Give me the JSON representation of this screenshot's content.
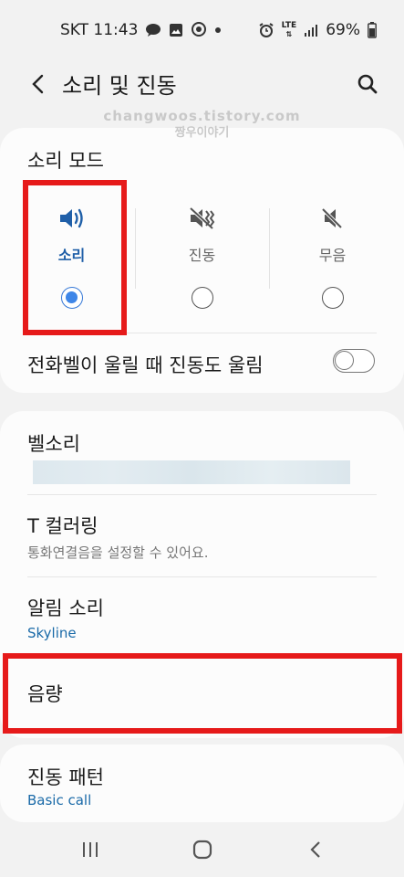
{
  "status_bar": {
    "carrier_time": "SKT 11:43",
    "battery": "69%",
    "lte_label": "LTE"
  },
  "header": {
    "title": "소리 및 진동"
  },
  "watermark": {
    "line1": "changwoos.tistory.com",
    "line2": "짱우이야기"
  },
  "sound_mode": {
    "title": "소리 모드",
    "options": [
      {
        "label": "소리",
        "selected": true
      },
      {
        "label": "진동",
        "selected": false
      },
      {
        "label": "무음",
        "selected": false
      }
    ],
    "vibrate_while_ringing_label": "전화벨이 울릴 때 진동도 울림",
    "vibrate_while_ringing_on": false
  },
  "settings": {
    "ringtone": {
      "title": "벨소리"
    },
    "t_coloring": {
      "title": "T 컬러링",
      "subtitle": "통화연결음을 설정할 수 있어요."
    },
    "notification_sound": {
      "title": "알림 소리",
      "subtitle": "Skyline"
    },
    "volume": {
      "title": "음량"
    },
    "vibration_pattern": {
      "title": "진동 패턴",
      "subtitle": "Basic call"
    }
  },
  "colors": {
    "accent_blue": "#1f5fa8",
    "radio_blue": "#3e86e8",
    "highlight_red": "#e61a1a"
  }
}
